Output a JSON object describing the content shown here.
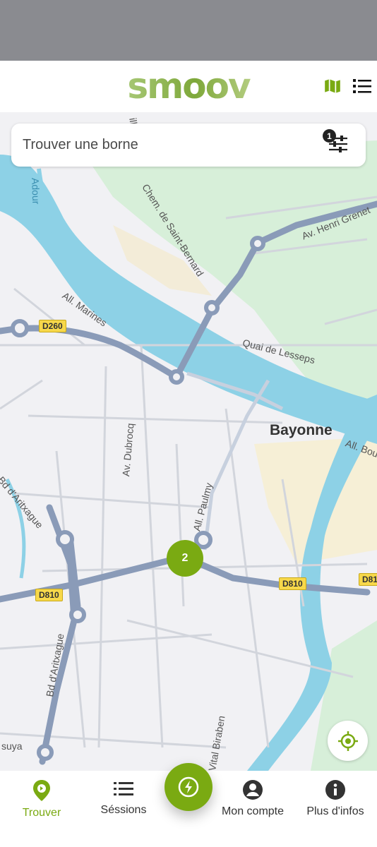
{
  "app": {
    "logo_text": "smoov",
    "brand_color": "#7aaa12"
  },
  "header": {
    "icons": [
      "map-icon",
      "list-icon"
    ]
  },
  "search": {
    "placeholder": "Trouver une borne",
    "filter_badge": "1"
  },
  "map": {
    "city": "Bayonne",
    "streets": [
      "Adour",
      "Chem. de Saint-Bernard",
      "Av. Henri Grenet",
      "All. Marines",
      "Quai de Lesseps",
      "Av. Dubrocq",
      "All. Paulmy",
      "Bd d'Aritxague",
      "Bd d'Aritxague",
      "Vital Biraben",
      "All. Boufflers",
      "suya",
      "ill"
    ],
    "road_shields": [
      "D260",
      "D810",
      "D810",
      "D81"
    ],
    "cluster_count": "2"
  },
  "nav": {
    "items": [
      {
        "label": "Trouver",
        "icon": "location-pin-icon",
        "active": true
      },
      {
        "label": "Séssions",
        "icon": "list-icon",
        "active": false
      },
      {
        "label": "Mon compte",
        "icon": "account-icon",
        "active": false
      },
      {
        "label": "Plus d'infos",
        "icon": "info-icon",
        "active": false
      }
    ],
    "fab_icon": "charge-bolt-icon"
  }
}
